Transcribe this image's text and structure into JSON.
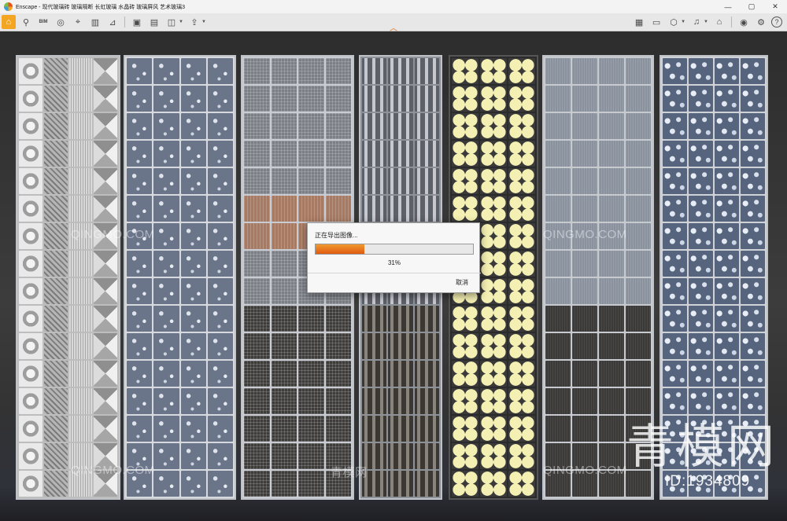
{
  "window": {
    "app_name": "Enscape",
    "title": "Enscape - 现代玻璃砖 玻璃隔断 长虹玻璃 水晶砖 玻璃屏风 艺术玻璃3",
    "controls": [
      "—",
      "▢",
      "✕"
    ]
  },
  "toolbar": {
    "left_icons": [
      "home-icon",
      "walk-icon",
      "bim-icon",
      "binoculars-icon",
      "pin-icon",
      "buildings-icon",
      "stairs-icon",
      "screenshot-icon",
      "batch-render-icon",
      "panorama-icon",
      "export-icon"
    ],
    "bim_label": "BIM",
    "right_icons": [
      "map-icon",
      "visual-settings-icon",
      "asset-library-icon",
      "material-icon",
      "collaborate-icon",
      "vr-icon",
      "settings-icon",
      "help-icon"
    ],
    "help_label": "?"
  },
  "dialog": {
    "title": "正在导出图像...",
    "progress": 0.31,
    "progress_text": "31%",
    "cancel_label": "取消"
  },
  "watermarks": {
    "site": "QINGMO.COM",
    "site_cn": "青模网",
    "big_cn": "青模网",
    "id_text": "ID:1934809"
  },
  "colors": {
    "accent": "#f4a623",
    "progress": "#e05a12"
  }
}
